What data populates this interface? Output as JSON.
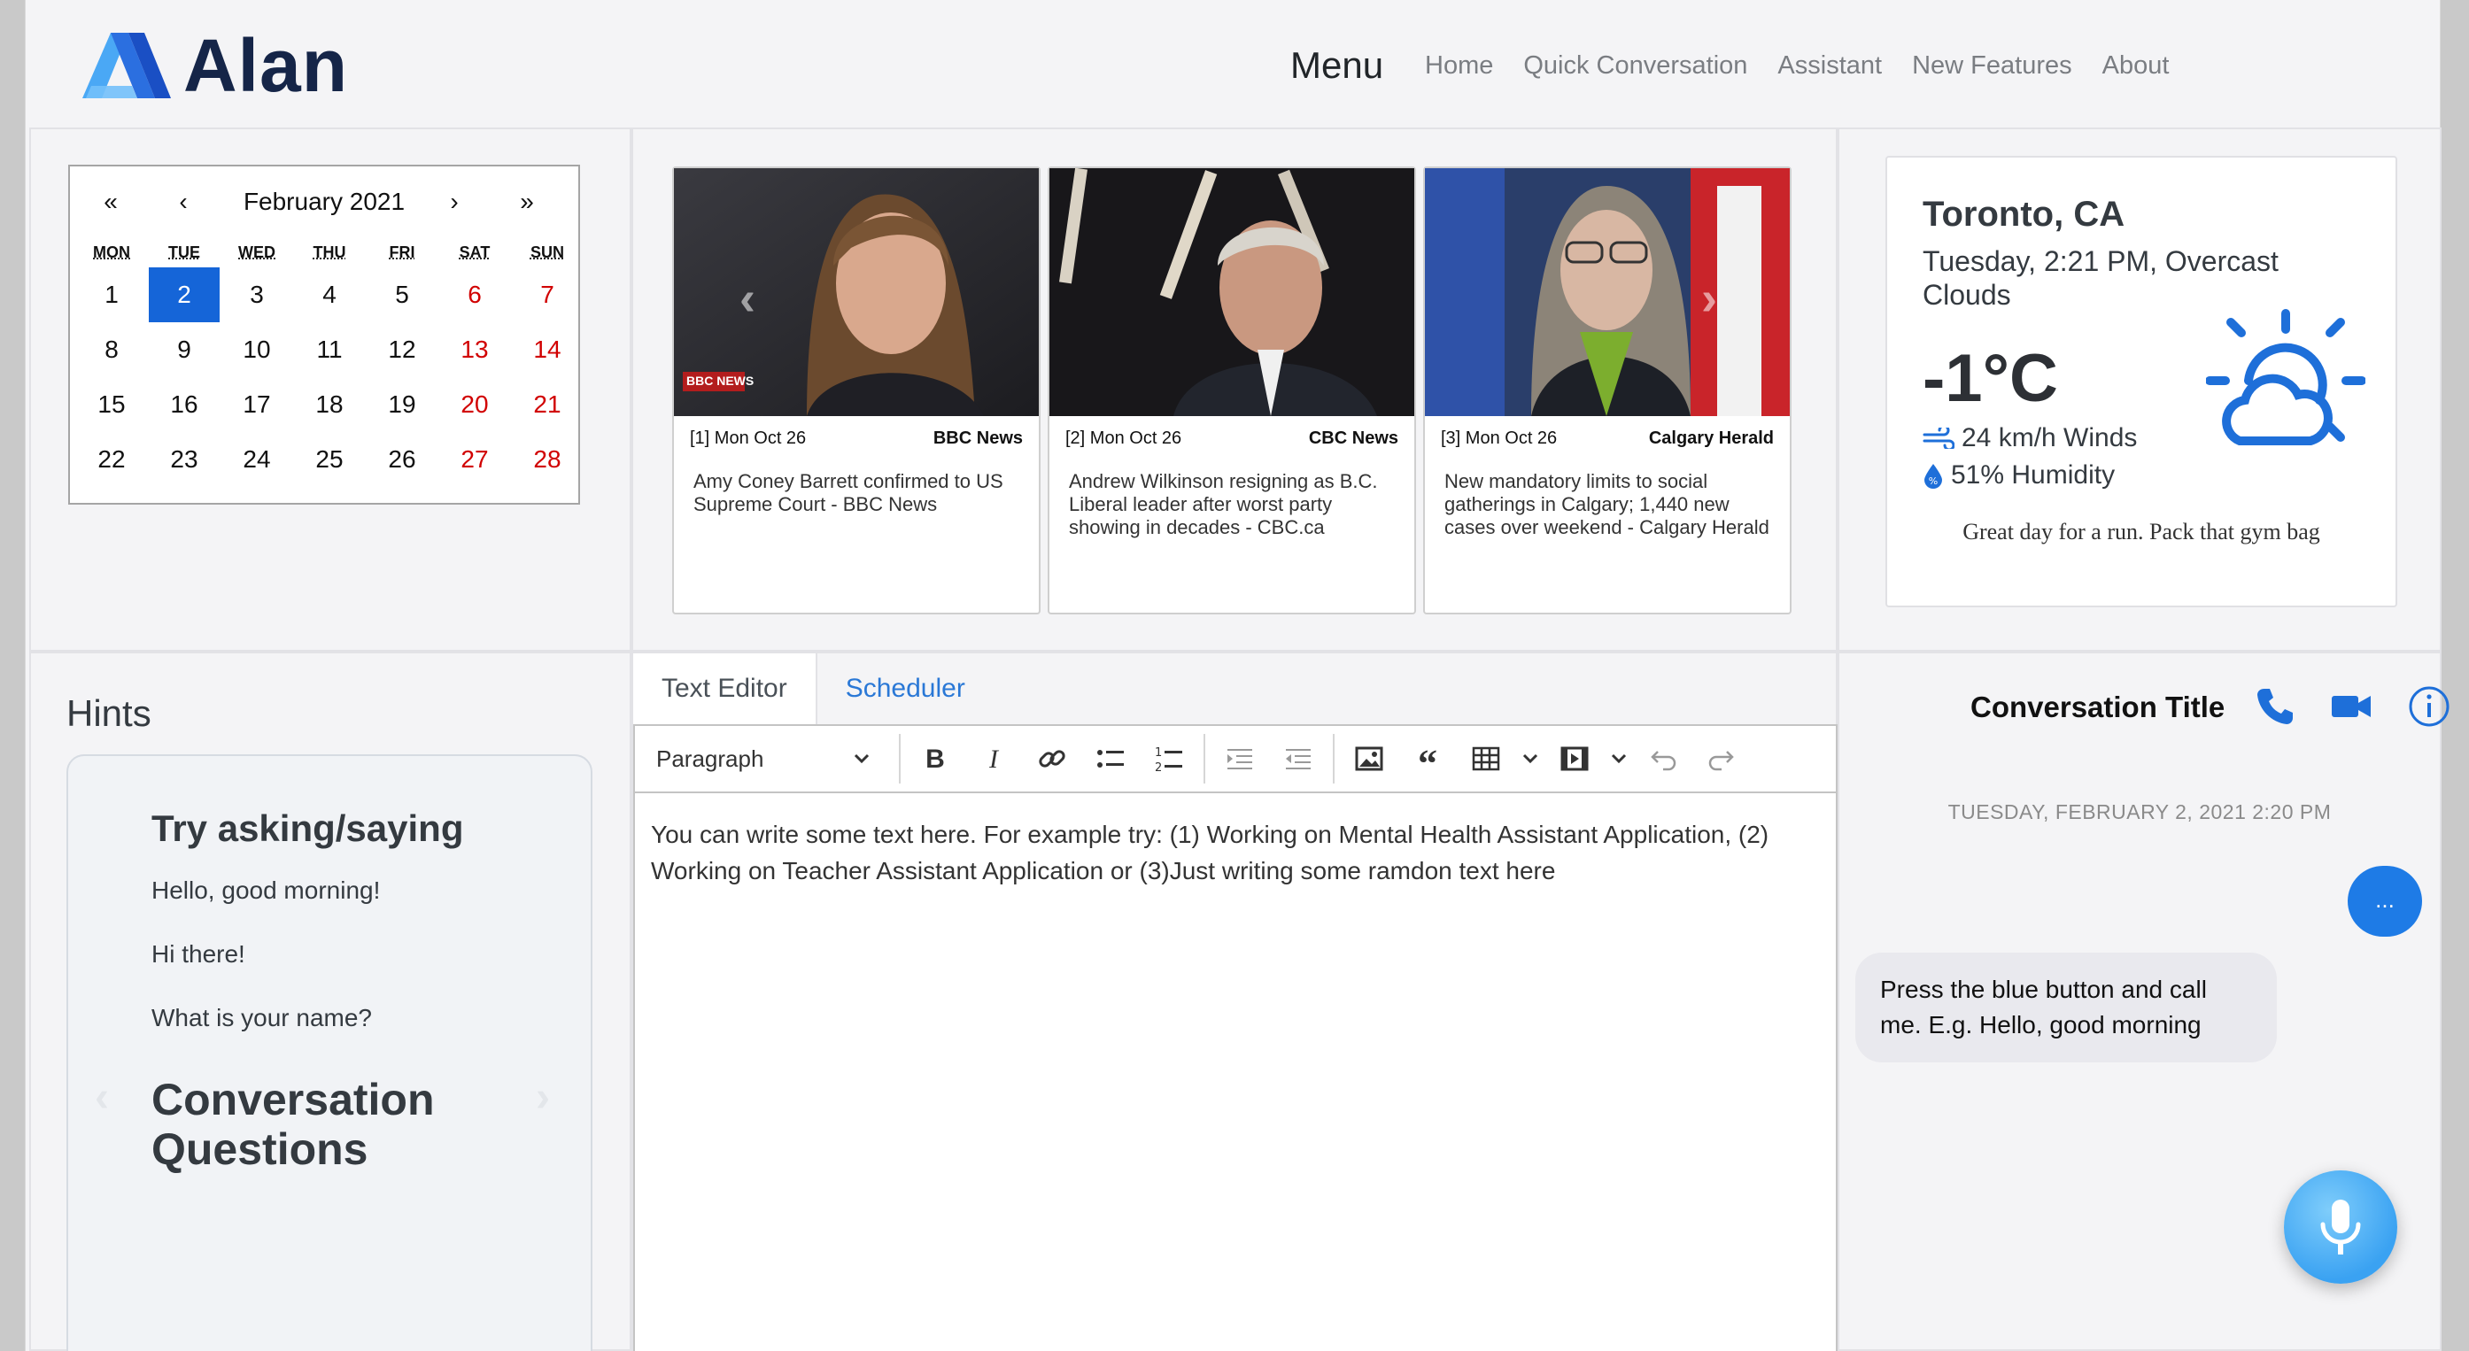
{
  "header": {
    "logo_text": "Alan",
    "menu_label": "Menu",
    "nav": [
      "Home",
      "Quick Conversation",
      "Assistant",
      "New Features",
      "About"
    ]
  },
  "calendar": {
    "month_label": "February 2021",
    "prev_year": "«",
    "prev_month": "‹",
    "next_month": "›",
    "next_year": "»",
    "weekdays": [
      "MON",
      "TUE",
      "WED",
      "THU",
      "FRI",
      "SAT",
      "SUN"
    ],
    "selected_day": "2",
    "weeks": [
      [
        "1",
        "2",
        "3",
        "4",
        "5",
        "6",
        "7"
      ],
      [
        "8",
        "9",
        "10",
        "11",
        "12",
        "13",
        "14"
      ],
      [
        "15",
        "16",
        "17",
        "18",
        "19",
        "20",
        "21"
      ],
      [
        "22",
        "23",
        "24",
        "25",
        "26",
        "27",
        "28"
      ]
    ]
  },
  "news": [
    {
      "index": "[1] Mon Oct 26",
      "source": "BBC News",
      "title": "Amy Coney Barrett confirmed to US Supreme Court - BBC News",
      "watermark": "BBC NEWS"
    },
    {
      "index": "[2] Mon Oct 26",
      "source": "CBC News",
      "title": "Andrew Wilkinson resigning as B.C. Liberal leader after worst party showing in decades - CBC.ca"
    },
    {
      "index": "[3] Mon Oct 26",
      "source": "Calgary Herald",
      "title": "New mandatory limits to social gatherings in Calgary; 1,440 new cases over weekend - Calgary Herald"
    }
  ],
  "weather": {
    "city": "Toronto, CA",
    "time_desc": "Tuesday, 2:21 PM, Overcast Clouds",
    "temp": "-1°C",
    "wind": "24 km/h Winds",
    "humidity": "51% Humidity",
    "note": "Great day for a run. Pack that gym bag",
    "icon": "partly-cloudy-icon"
  },
  "hints": {
    "title": "Hints",
    "heading": "Try asking/saying",
    "items": [
      "Hello, good morning!",
      "Hi there!",
      "What is your name?"
    ],
    "heading2": "Conversation Questions"
  },
  "editor": {
    "tabs": [
      "Text Editor",
      "Scheduler"
    ],
    "block_format": "Paragraph",
    "content": "You can write some text here. For example try: (1) Working on Mental Health Assistant Application, (2) Working on Teacher Assistant Application or (3)Just writing some ramdon text here"
  },
  "chat": {
    "title": "Conversation Title",
    "date": "TUESDAY, FEBRUARY 2, 2021 2:20 PM",
    "typing": "...",
    "bot_message": "Press the blue button and call me. E.g. Hello, good morning"
  },
  "colors": {
    "accent": "#1565d8",
    "link": "#2a78d6",
    "weekend": "#d10000",
    "mic": "#3aa2f2"
  }
}
